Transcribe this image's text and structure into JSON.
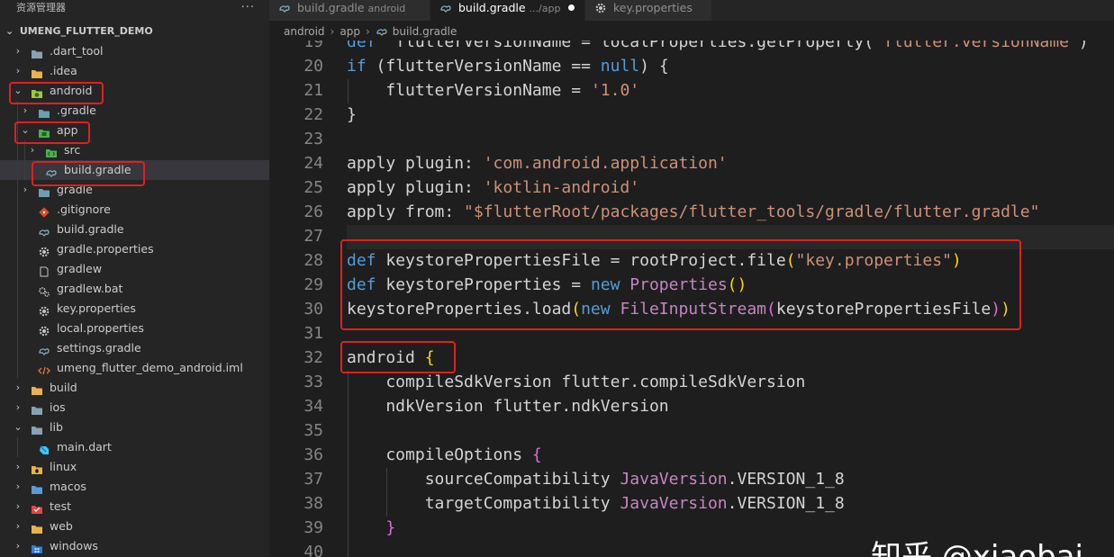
{
  "sidebar": {
    "title": "资源管理器",
    "more_glyph": "···",
    "root_label": "UMENG_FLUTTER_DEMO",
    "items": [
      {
        "label": ".dart_tool",
        "depth": 1,
        "chevron": "›",
        "icon": "folder-icon",
        "color": "#8aa1b1"
      },
      {
        "label": ".idea",
        "depth": 1,
        "chevron": "›",
        "icon": "folder-icon",
        "color": "#e8b34a"
      },
      {
        "label": "android",
        "depth": 1,
        "chevron": "⌄",
        "icon": "android-folder-icon",
        "color": "#a4c639"
      },
      {
        "label": ".gradle",
        "depth": 2,
        "chevron": "›",
        "icon": "gradle-folder-icon",
        "color": "#6a9fb5"
      },
      {
        "label": "app",
        "depth": 2,
        "chevron": "⌄",
        "icon": "app-folder-icon",
        "color": "#4caf50"
      },
      {
        "label": "src",
        "depth": 3,
        "chevron": "›",
        "icon": "src-folder-icon",
        "color": "#4caf50"
      },
      {
        "label": "build.gradle",
        "depth": 3,
        "chevron": "",
        "icon": "gradle-file-icon",
        "color": "#8ab4c7",
        "selected": true
      },
      {
        "label": "gradle",
        "depth": 2,
        "chevron": "›",
        "icon": "gradle-folder-icon",
        "color": "#6a9fb5"
      },
      {
        "label": ".gitignore",
        "depth": 2,
        "chevron": "",
        "icon": "git-icon",
        "color": "#e44d26"
      },
      {
        "label": "build.gradle",
        "depth": 2,
        "chevron": "",
        "icon": "gradle-file-icon",
        "color": "#8ab4c7"
      },
      {
        "label": "gradle.properties",
        "depth": 2,
        "chevron": "",
        "icon": "gear-icon",
        "color": "#c5c5c5"
      },
      {
        "label": "gradlew",
        "depth": 2,
        "chevron": "",
        "icon": "file-icon",
        "color": "#c5c5c5"
      },
      {
        "label": "gradlew.bat",
        "depth": 2,
        "chevron": "",
        "icon": "gears-icon",
        "color": "#c5c5c5"
      },
      {
        "label": "key.properties",
        "depth": 2,
        "chevron": "",
        "icon": "gear-icon",
        "color": "#c5c5c5"
      },
      {
        "label": "local.properties",
        "depth": 2,
        "chevron": "",
        "icon": "gear-icon",
        "color": "#c5c5c5"
      },
      {
        "label": "settings.gradle",
        "depth": 2,
        "chevron": "",
        "icon": "gradle-file-icon",
        "color": "#8ab4c7"
      },
      {
        "label": "umeng_flutter_demo_android.iml",
        "depth": 2,
        "chevron": "",
        "icon": "xml-icon",
        "color": "#e37933"
      },
      {
        "label": "build",
        "depth": 1,
        "chevron": "›",
        "icon": "folder-icon",
        "color": "#e8b34a"
      },
      {
        "label": "ios",
        "depth": 1,
        "chevron": "›",
        "icon": "ios-folder-icon",
        "color": "#8aa1b1"
      },
      {
        "label": "lib",
        "depth": 1,
        "chevron": "⌄",
        "icon": "lib-folder-icon",
        "color": "#8aa1b1"
      },
      {
        "label": "main.dart",
        "depth": 2,
        "chevron": "",
        "icon": "dart-icon",
        "color": "#40c4ff"
      },
      {
        "label": "linux",
        "depth": 1,
        "chevron": "›",
        "icon": "linux-folder-icon",
        "color": "#e8b34a"
      },
      {
        "label": "macos",
        "depth": 1,
        "chevron": "›",
        "icon": "macos-folder-icon",
        "color": "#5b9bd5"
      },
      {
        "label": "test",
        "depth": 1,
        "chevron": "›",
        "icon": "test-folder-icon",
        "color": "#e04848"
      },
      {
        "label": "web",
        "depth": 1,
        "chevron": "›",
        "icon": "web-folder-icon",
        "color": "#e8b34a"
      },
      {
        "label": "windows",
        "depth": 1,
        "chevron": "›",
        "icon": "windows-folder-icon",
        "color": "#2f7fd8"
      }
    ]
  },
  "tabs": [
    {
      "label": "build.gradle",
      "desc": "android",
      "icon": "gradle-file-icon",
      "active": false
    },
    {
      "label": "build.gradle",
      "desc": ".../app",
      "icon": "gradle-file-icon",
      "active": true,
      "modified": true
    },
    {
      "label": "key.properties",
      "desc": "",
      "icon": "gear-icon",
      "active": false
    }
  ],
  "breadcrumb": [
    "android",
    "app",
    "build.gradle"
  ],
  "editor": {
    "lines": [
      {
        "n": 19,
        "tokens": [
          [
            "kw",
            "def"
          ],
          [
            "",
            "  flutterVersionName = localProperties.getProperty("
          ],
          [
            "str",
            "'flutter.versionName'"
          ],
          [
            "",
            ")"
          ]
        ]
      },
      {
        "n": 20,
        "tokens": [
          [
            "kw",
            "if"
          ],
          [
            "",
            " ("
          ],
          [
            "",
            "flutterVersionName == "
          ],
          [
            "kw",
            "null"
          ],
          [
            "",
            ") {"
          ]
        ]
      },
      {
        "n": 21,
        "tokens": [
          [
            "",
            "    flutterVersionName = "
          ],
          [
            "str",
            "'1.0'"
          ]
        ]
      },
      {
        "n": 22,
        "tokens": [
          [
            "",
            "}"
          ]
        ]
      },
      {
        "n": 23,
        "tokens": []
      },
      {
        "n": 24,
        "tokens": [
          [
            "",
            "apply plugin: "
          ],
          [
            "str",
            "'com.android.application'"
          ]
        ]
      },
      {
        "n": 25,
        "tokens": [
          [
            "",
            "apply plugin: "
          ],
          [
            "str",
            "'kotlin-android'"
          ]
        ]
      },
      {
        "n": 26,
        "tokens": [
          [
            "",
            "apply from: "
          ],
          [
            "str",
            "\"$flutterRoot/packages/flutter_tools/gradle/flutter.gradle\""
          ]
        ]
      },
      {
        "n": 27,
        "tokens": [],
        "highlight": true
      },
      {
        "n": 28,
        "tokens": [
          [
            "kw",
            "def"
          ],
          [
            "",
            " keystorePropertiesFile = rootProject.file"
          ],
          [
            "b1",
            "("
          ],
          [
            "str",
            "\"key.properties\""
          ],
          [
            "b1",
            ")"
          ]
        ]
      },
      {
        "n": 29,
        "tokens": [
          [
            "kw",
            "def"
          ],
          [
            "",
            " keystoreProperties = "
          ],
          [
            "kw",
            "new"
          ],
          [
            "",
            " "
          ],
          [
            "cls",
            "Properties"
          ],
          [
            "b1",
            "()"
          ]
        ]
      },
      {
        "n": 30,
        "tokens": [
          [
            "",
            "keystoreProperties.load"
          ],
          [
            "b1",
            "("
          ],
          [
            "kw",
            "new"
          ],
          [
            "",
            " "
          ],
          [
            "cls",
            "FileInputStream"
          ],
          [
            "b2",
            "("
          ],
          [
            "",
            "keystorePropertiesFile"
          ],
          [
            "b2",
            ")"
          ],
          [
            "b1",
            ")"
          ]
        ]
      },
      {
        "n": 31,
        "tokens": []
      },
      {
        "n": 32,
        "tokens": [
          [
            "",
            "android "
          ],
          [
            "b1",
            "{"
          ]
        ]
      },
      {
        "n": 33,
        "tokens": [
          [
            "",
            "    compileSdkVersion flutter.compileSdkVersion"
          ]
        ]
      },
      {
        "n": 34,
        "tokens": [
          [
            "",
            "    ndkVersion flutter.ndkVersion"
          ]
        ]
      },
      {
        "n": 35,
        "tokens": []
      },
      {
        "n": 36,
        "tokens": [
          [
            "",
            "    compileOptions "
          ],
          [
            "b2",
            "{"
          ]
        ]
      },
      {
        "n": 37,
        "tokens": [
          [
            "",
            "        sourceCompatibility "
          ],
          [
            "cls",
            "JavaVersion"
          ],
          [
            "",
            ".VERSION_1_8"
          ]
        ]
      },
      {
        "n": 38,
        "tokens": [
          [
            "",
            "        targetCompatibility "
          ],
          [
            "cls",
            "JavaVersion"
          ],
          [
            "",
            ".VERSION_1_8"
          ]
        ]
      },
      {
        "n": 39,
        "tokens": [
          [
            "",
            "    "
          ],
          [
            "b2",
            "}"
          ]
        ]
      },
      {
        "n": 40,
        "tokens": []
      }
    ]
  },
  "watermark": "知乎 @xiaobai",
  "colors": {
    "annotation_red": "#e02020",
    "keyword": "#569cd6",
    "string": "#ce9178",
    "class": "#c586c0",
    "bracket_1": "#ffd700",
    "bracket_2": "#da70d6"
  }
}
